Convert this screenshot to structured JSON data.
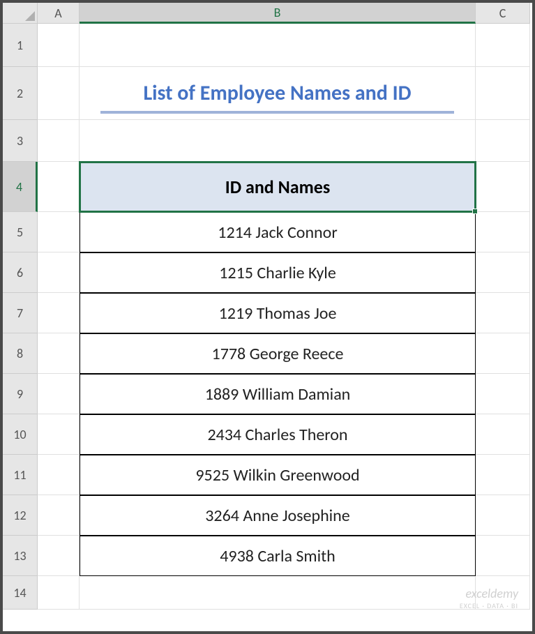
{
  "columns": {
    "a": "A",
    "b": "B",
    "c": "C"
  },
  "rows": [
    "1",
    "2",
    "3",
    "4",
    "5",
    "6",
    "7",
    "8",
    "9",
    "10",
    "11",
    "12",
    "13",
    "14"
  ],
  "title": "List of Employee Names and ID",
  "table": {
    "header": "ID and Names",
    "rows": [
      "1214 Jack Connor",
      "1215 Charlie Kyle",
      "1219 Thomas Joe",
      "1778 George Reece",
      "1889 William Damian",
      "2434 Charles Theron",
      "9525 Wilkin Greenwood",
      "3264 Anne Josephine",
      "4938 Carla Smith"
    ]
  },
  "watermark": {
    "main": "exceldemy",
    "sub": "EXCEL · DATA · BI"
  },
  "active_cell": "B4"
}
